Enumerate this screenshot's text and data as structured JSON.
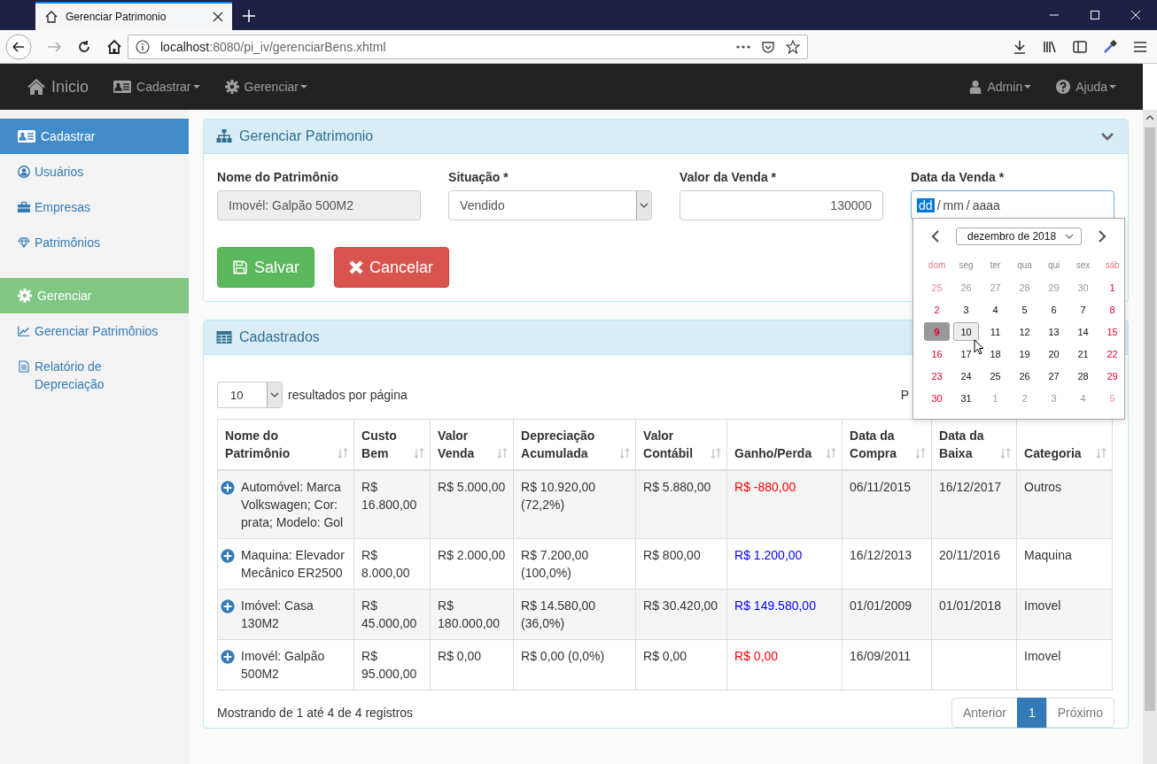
{
  "browser": {
    "tab_title": "Gerenciar Patrimonio",
    "url_host": "localhost",
    "url_rest": ":8080/pi_iv/gerenciarBens.xhtml"
  },
  "navbar": {
    "brand": "Inicio",
    "left": [
      {
        "label": "Cadastrar"
      },
      {
        "label": "Gerenciar"
      }
    ],
    "right": [
      {
        "label": "Admin"
      },
      {
        "label": "Ajuda"
      }
    ]
  },
  "sidebar": [
    {
      "title": "Cadastrar",
      "color": "#428bca",
      "items": [
        {
          "label": "Usuários"
        },
        {
          "label": "Empresas"
        },
        {
          "label": "Patrimônios"
        }
      ]
    },
    {
      "title": "Gerenciar",
      "color": "#7fc783",
      "items": [
        {
          "label": "Gerenciar Patrimônios"
        },
        {
          "label": "Relatório de Depreciação"
        }
      ]
    }
  ],
  "form_panel": {
    "title": "Gerenciar Patrimonio",
    "fields": [
      {
        "kind": "readonly",
        "label": "Nome do Patrimônio",
        "value": "Imovél: Galpão 500M2"
      },
      {
        "kind": "select",
        "label": "Situação *",
        "value": "Vendido"
      },
      {
        "kind": "number",
        "label": "Valor da Venda *",
        "value": "130000"
      },
      {
        "kind": "date",
        "label": "Data da Venda *",
        "segments": [
          {
            "text": "dd",
            "selected": true
          },
          {
            "text": "/",
            "selected": false
          },
          {
            "text": "mm",
            "selected": false
          },
          {
            "text": "/",
            "selected": false
          },
          {
            "text": "aaaa",
            "selected": false
          }
        ]
      }
    ],
    "buttons": [
      {
        "label": "Salvar",
        "kind": "save"
      },
      {
        "label": "Cancelar",
        "kind": "cancel"
      }
    ]
  },
  "calendar": {
    "month": "dezembro de 2018",
    "weekdays": [
      "dom",
      "seg",
      "ter",
      "qua",
      "qui",
      "sex",
      "sáb"
    ],
    "weeks": [
      [
        {
          "day": "25",
          "other": true,
          "selected": false,
          "focused": false
        },
        {
          "day": "26",
          "other": true,
          "selected": false,
          "focused": false
        },
        {
          "day": "27",
          "other": true,
          "selected": false,
          "focused": false
        },
        {
          "day": "28",
          "other": true,
          "selected": false,
          "focused": false
        },
        {
          "day": "29",
          "other": true,
          "selected": false,
          "focused": false
        },
        {
          "day": "30",
          "other": true,
          "selected": false,
          "focused": false
        },
        {
          "day": "1",
          "other": false,
          "selected": false,
          "focused": false
        }
      ],
      [
        {
          "day": "2",
          "other": false,
          "selected": false,
          "focused": false
        },
        {
          "day": "3",
          "other": false,
          "selected": false,
          "focused": false
        },
        {
          "day": "4",
          "other": false,
          "selected": false,
          "focused": false
        },
        {
          "day": "5",
          "other": false,
          "selected": false,
          "focused": false
        },
        {
          "day": "6",
          "other": false,
          "selected": false,
          "focused": false
        },
        {
          "day": "7",
          "other": false,
          "selected": false,
          "focused": false
        },
        {
          "day": "8",
          "other": false,
          "selected": false,
          "focused": false
        }
      ],
      [
        {
          "day": "9",
          "other": false,
          "selected": true,
          "focused": false
        },
        {
          "day": "10",
          "other": false,
          "selected": false,
          "focused": true
        },
        {
          "day": "11",
          "other": false,
          "selected": false,
          "focused": false
        },
        {
          "day": "12",
          "other": false,
          "selected": false,
          "focused": false
        },
        {
          "day": "13",
          "other": false,
          "selected": false,
          "focused": false
        },
        {
          "day": "14",
          "other": false,
          "selected": false,
          "focused": false
        },
        {
          "day": "15",
          "other": false,
          "selected": false,
          "focused": false
        }
      ],
      [
        {
          "day": "16",
          "other": false,
          "selected": false,
          "focused": false
        },
        {
          "day": "17",
          "other": false,
          "selected": false,
          "focused": false
        },
        {
          "day": "18",
          "other": false,
          "selected": false,
          "focused": false
        },
        {
          "day": "19",
          "other": false,
          "selected": false,
          "focused": false
        },
        {
          "day": "20",
          "other": false,
          "selected": false,
          "focused": false
        },
        {
          "day": "21",
          "other": false,
          "selected": false,
          "focused": false
        },
        {
          "day": "22",
          "other": false,
          "selected": false,
          "focused": false
        }
      ],
      [
        {
          "day": "23",
          "other": false,
          "selected": false,
          "focused": false
        },
        {
          "day": "24",
          "other": false,
          "selected": false,
          "focused": false
        },
        {
          "day": "25",
          "other": false,
          "selected": false,
          "focused": false
        },
        {
          "day": "26",
          "other": false,
          "selected": false,
          "focused": false
        },
        {
          "day": "27",
          "other": false,
          "selected": false,
          "focused": false
        },
        {
          "day": "28",
          "other": false,
          "selected": false,
          "focused": false
        },
        {
          "day": "29",
          "other": false,
          "selected": false,
          "focused": false
        }
      ],
      [
        {
          "day": "30",
          "other": false,
          "selected": false,
          "focused": false
        },
        {
          "day": "31",
          "other": false,
          "selected": false,
          "focused": false
        },
        {
          "day": "1",
          "other": true,
          "selected": false,
          "focused": false
        },
        {
          "day": "2",
          "other": true,
          "selected": false,
          "focused": false
        },
        {
          "day": "3",
          "other": true,
          "selected": false,
          "focused": false
        },
        {
          "day": "4",
          "other": true,
          "selected": false,
          "focused": false
        },
        {
          "day": "5",
          "other": true,
          "selected": false,
          "focused": false
        }
      ]
    ]
  },
  "table_panel": {
    "title": "Cadastrados",
    "page_size": "10",
    "page_size_label": "resultados por página",
    "search_label": "P",
    "columns": [
      "Nome do Patrimônio",
      "Custo Bem",
      "Valor Venda",
      "Depreciação Acumulada",
      "Valor Contábil",
      "Ganho/Perda",
      "Data da Compra",
      "Data da Baixa",
      "Categoria"
    ],
    "rows": [
      {
        "name": "Automóvel: Marca Volkswagen; Cor: prata; Modelo: Gol",
        "cost": "R$ 16.800,00",
        "sale": "R$ 5.000,00",
        "depreciation": "R$ 10.920,00 (72,2%)",
        "book": "R$ 5.880,00",
        "gain": "R$ -880,00",
        "color": "#ff0000",
        "bought": "06/11/2015",
        "disposed": "16/12/2017",
        "category": "Outros"
      },
      {
        "name": "Maquina: Elevador Mecânico ER2500",
        "cost": "R$ 8.000,00",
        "sale": "R$ 2.000,00",
        "depreciation": "R$ 7.200,00 (100,0%)",
        "book": "R$ 800,00",
        "gain": "R$ 1.200,00",
        "color": "#0000ff",
        "bought": "16/12/2013",
        "disposed": "20/11/2016",
        "category": "Maquina"
      },
      {
        "name": "Imóvel: Casa 130M2",
        "cost": "R$ 45.000,00",
        "sale": "R$ 180.000,00",
        "depreciation": "R$ 14.580,00 (36,0%)",
        "book": "R$ 30.420,00",
        "gain": "R$ 149.580,00",
        "color": "#0000ff",
        "bought": "01/01/2009",
        "disposed": "01/01/2018",
        "category": "Imovel"
      },
      {
        "name": "Imovél: Galpão 500M2",
        "cost": "R$ 95.000,00",
        "sale": "R$ 0,00",
        "depreciation": "R$ 0,00 (0,0%)",
        "book": "R$ 0,00",
        "gain": "R$ 0,00",
        "color": "#ff0000",
        "bought": "16/09/2011",
        "category": "Imovel"
      }
    ],
    "info": "Mostrando de 1 até 4 de 4 registros",
    "pagination": [
      {
        "label": "Anterior",
        "selected": false
      },
      {
        "label": "1",
        "selected": true
      },
      {
        "label": "Próximo",
        "selected": false
      }
    ]
  }
}
